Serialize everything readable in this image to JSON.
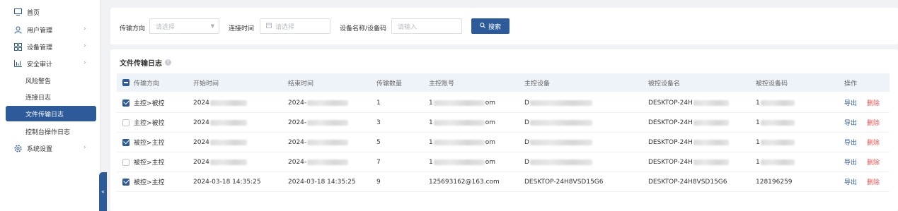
{
  "sidebar": {
    "items": [
      {
        "label": "首页",
        "icon": "monitor-icon"
      },
      {
        "label": "用户管理",
        "icon": "user-icon"
      },
      {
        "label": "设备管理",
        "icon": "grid-icon"
      },
      {
        "label": "安全审计",
        "icon": "bar-chart-icon"
      },
      {
        "label": "系统设置",
        "icon": "gear-icon"
      }
    ],
    "audit_sub": [
      {
        "label": "风险警告"
      },
      {
        "label": "连接日志"
      },
      {
        "label": "文件传输日志"
      },
      {
        "label": "控制台操作日志"
      }
    ],
    "collapse": "«"
  },
  "search": {
    "direction_label": "传输方向",
    "direction_placeholder": "请选择",
    "time_label": "连接时间",
    "time_placeholder": "请选择",
    "device_label": "设备名称/设备码",
    "device_placeholder": "请输入",
    "button": "搜索"
  },
  "panel": {
    "title": "文件传输日志",
    "help": "?"
  },
  "table": {
    "headers": [
      "传输方向",
      "开始时间",
      "结束时间",
      "传输数量",
      "主控账号",
      "主控设备",
      "被控设备名",
      "被控设备码",
      "操作"
    ],
    "rows": [
      {
        "checked": true,
        "direction": "主控>被控",
        "start": "2024",
        "end": "2024-",
        "count": "1",
        "account_a": "1",
        "account_b": "om",
        "device": "D",
        "target": "DESKTOP-24H",
        "code": "1",
        "export": "导出",
        "delete": "删除"
      },
      {
        "checked": false,
        "direction": "主控>被控",
        "start": "2024",
        "end": "2024-",
        "count": "3",
        "account_a": "1",
        "account_b": "om",
        "device": "D",
        "target": "DESKTOP-24H",
        "code": "1",
        "export": "导出",
        "delete": "删除"
      },
      {
        "checked": true,
        "direction": "被控>主控",
        "start": "2024",
        "end": "2024-",
        "count": "5",
        "account_a": "1",
        "account_b": "om",
        "device": "D",
        "target": "DESKTOP-24H",
        "code": "1",
        "export": "导出",
        "delete": "删除"
      },
      {
        "checked": false,
        "direction": "被控>主控",
        "start": "2024",
        "end": "2024-",
        "count": "7",
        "account_a": "1",
        "account_b": "om",
        "device": "D",
        "target": "DESKTOP-24H",
        "code": "1",
        "export": "导出",
        "delete": "删除"
      },
      {
        "checked": true,
        "direction": "被控>主控",
        "start": "2024-03-18 14:35:25",
        "end": "2024-03-18 14:35:25",
        "count": "9",
        "account_a": "125693162@163.com",
        "account_b": "",
        "device": "DESKTOP-24H8VSD15G6",
        "target": "DESKTOP-24H8VSD15G6",
        "code": "128196259",
        "export": "导出",
        "delete": "删除"
      }
    ]
  },
  "colors": {
    "accent": "#2d5b9a",
    "danger": "#e55454"
  }
}
